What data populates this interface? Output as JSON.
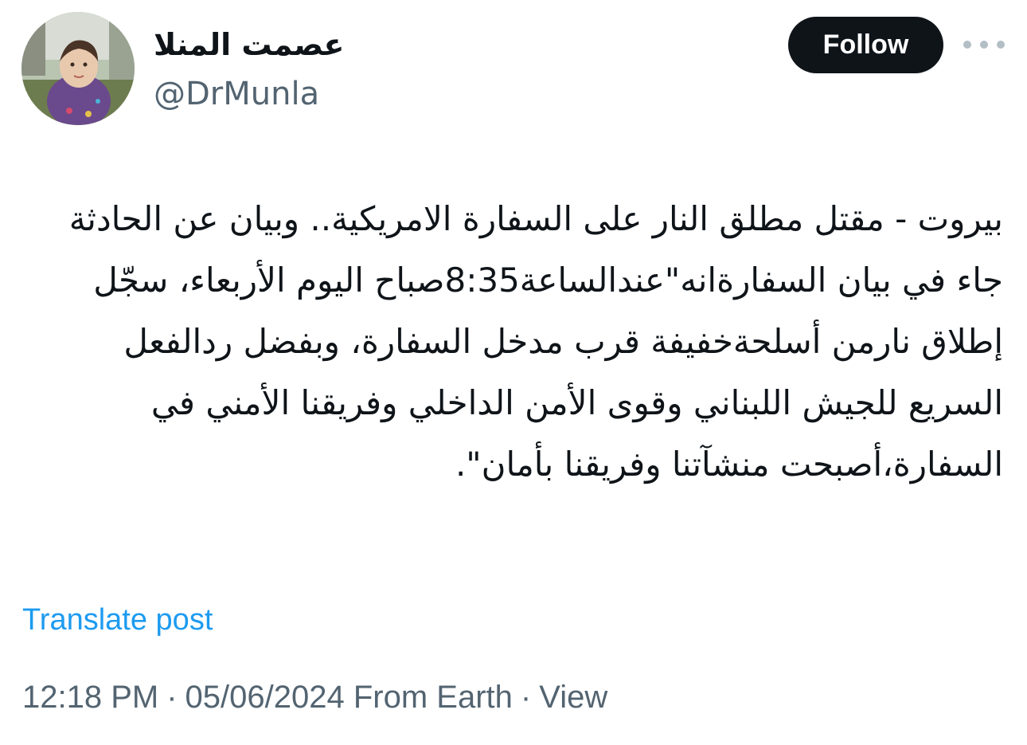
{
  "author": {
    "display_name": "عصمت المنلا",
    "handle": "@DrMunla"
  },
  "header": {
    "follow_label": "Follow",
    "more_icon": "more-horizontal-icon"
  },
  "tweet": {
    "paragraphs": [
      "بيروت - مقتل مطلق النار على السفارة الامريكية.. وبيان عن الحادثة",
      "جاء في بيان السفارةانه\"عندالساعة8:35صباح اليوم الأربعاء، سجّل إطلاق نارمن أسلحةخفيفة قرب مدخل السفارة، وبفضل ردالفعل السريع للجيش اللبناني وقوى الأمن الداخلي وفريقنا الأمني في السفارة،أصبحت منشآتنا وفريقنا بأمان\"."
    ]
  },
  "translate_label": "Translate post",
  "meta": {
    "time": "12:18 PM",
    "date": "05/06/2024",
    "source": "From Earth",
    "view_label": "View",
    "separator": "·"
  },
  "colors": {
    "text": "#0f1419",
    "secondary": "#536471",
    "link": "#1d9bf0",
    "button_bg": "#0f1419"
  }
}
